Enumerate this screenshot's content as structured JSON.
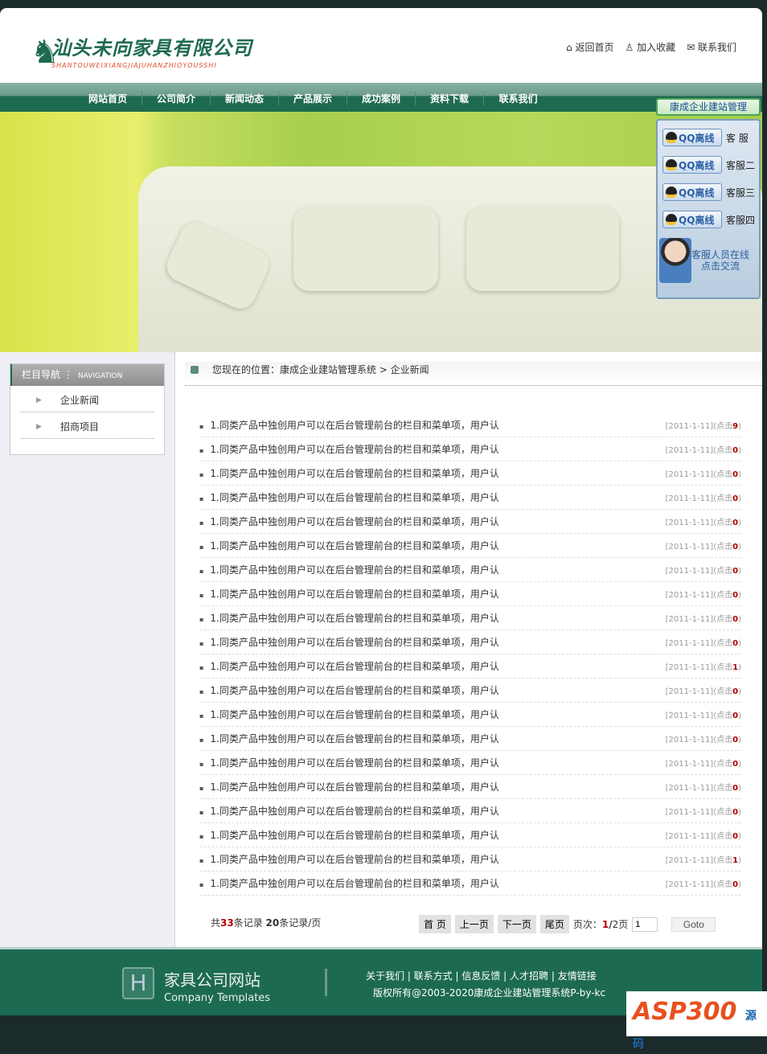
{
  "header": {
    "company_name": "汕头未向家具有限公司",
    "company_pinyin": "SHANTOUWEIXIANGJIAJUHANZHIOYOUSSHI",
    "links": [
      "返回首页",
      "加入收藏",
      "联系我们"
    ]
  },
  "nav": [
    "网站首页",
    "公司简介",
    "新闻动态",
    "产品展示",
    "成功案例",
    "资料下载",
    "联系我们"
  ],
  "qq": {
    "title": "康成企业建站管理",
    "btn": "QQ离线",
    "agents": [
      "客 服",
      "客服二",
      "客服三",
      "客服四"
    ],
    "online_line1": "客服人员在线",
    "online_line2": "点击交流"
  },
  "sidebar": {
    "title": "栏目导航",
    "title_en": "NAVIGATION",
    "items": [
      "企业新闻",
      "招商项目"
    ]
  },
  "breadcrumb": "您现在的位置：康成企业建站管理系统 > 企业新闻",
  "news": {
    "title": "1.同类产品中独创用户可以在后台管理前台的栏目和菜单项，用户认",
    "date": "[2011-1-11]",
    "click_label": "点击",
    "clicks": [
      9,
      0,
      0,
      0,
      0,
      0,
      0,
      0,
      0,
      0,
      1,
      0,
      0,
      0,
      0,
      0,
      0,
      0,
      1,
      0
    ]
  },
  "count": {
    "pre": "共",
    "total": "33",
    "mid": "条记录 ",
    "per": "20",
    "post": "条记录/页"
  },
  "pager": {
    "first": "首 页",
    "prev": "上一页",
    "next": "下一页",
    "last": "尾页",
    "label": "页次：",
    "current": "1",
    "sep": "/",
    "pages": "2页",
    "input": "1",
    "goto": "Goto"
  },
  "footer": {
    "brand": "家具公司网站",
    "brand_en": "Company Templates",
    "links": "关于我们 | 联系方式 | 信息反馈 | 人才招聘 | 友情链接",
    "copyright": "版权所有@2003-2020康成企业建站管理系统P-by-kc"
  },
  "watermark": {
    "text": "ASP300",
    "suffix": "源码"
  }
}
